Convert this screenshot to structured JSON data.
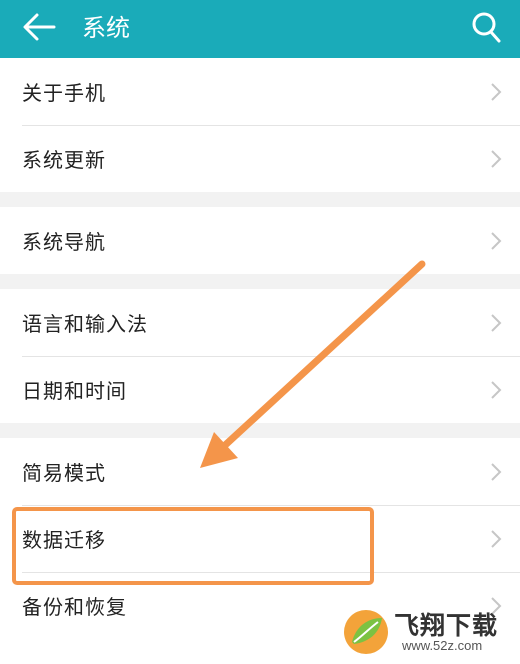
{
  "colors": {
    "header_bg": "#1aabb9",
    "accent": "#f4954a",
    "text": "#222222",
    "chevron": "#c6c6c6"
  },
  "header": {
    "title": "系统",
    "back_icon": "arrow-left-icon",
    "search_icon": "search-icon"
  },
  "groups": [
    {
      "items": [
        {
          "label": "关于手机"
        },
        {
          "label": "系统更新"
        }
      ]
    },
    {
      "items": [
        {
          "label": "系统导航"
        }
      ]
    },
    {
      "items": [
        {
          "label": "语言和输入法"
        },
        {
          "label": "日期和时间"
        }
      ]
    },
    {
      "items": [
        {
          "label": "简易模式"
        },
        {
          "label": "数据迁移"
        },
        {
          "label": "备份和恢复"
        }
      ]
    }
  ],
  "watermark": {
    "name": "飞翔下载",
    "url": "www.52z.com"
  }
}
